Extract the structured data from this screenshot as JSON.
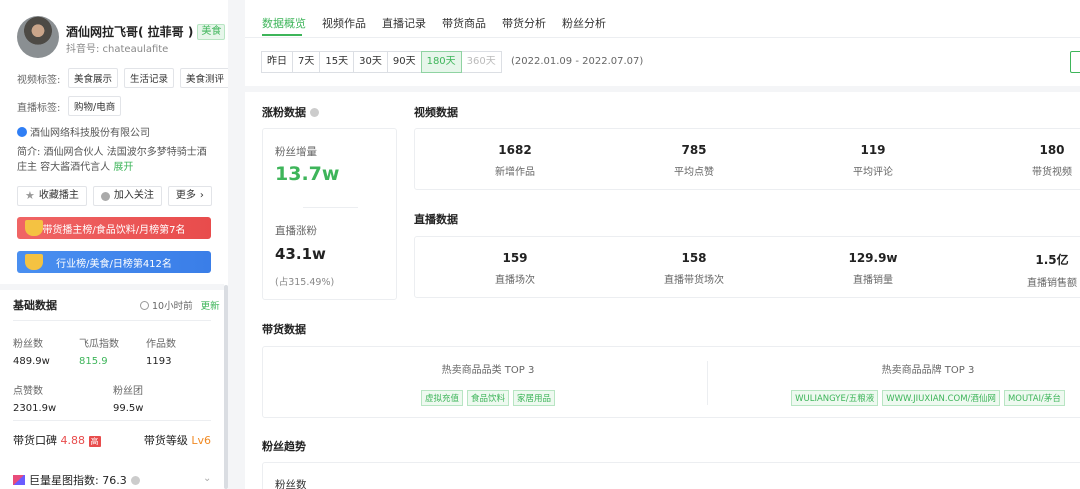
{
  "profile": {
    "name": "酒仙网拉飞哥( 拉菲哥 )",
    "category_tag": "美食",
    "douyin_id": "抖音号: chateaulafite",
    "video_tags_label": "视频标签:",
    "video_tags": [
      "美食展示",
      "生活记录",
      "美食测评"
    ],
    "live_tags_label": "直播标签:",
    "live_tags": [
      "购物/电商"
    ],
    "verified_org": "酒仙网络科技股份有限公司",
    "intro": "简介: 酒仙网合伙人 法国波尔多梦特骑士酒庄主 容大酱酒代言人",
    "intro_more": "展开",
    "actions": {
      "collect": "收藏播主",
      "follow": "加入关注",
      "more": "更多"
    },
    "rank_red": "带货播主榜/食品饮料/月榜第7名",
    "rank_blue": "行业榜/美食/日榜第412名"
  },
  "basic": {
    "title": "基础数据",
    "updated": "10小时前",
    "update_link": "更新",
    "stats": [
      {
        "label": "粉丝数",
        "value": "489.9w"
      },
      {
        "label": "飞瓜指数",
        "value": "815.9"
      },
      {
        "label": "作品数",
        "value": "1193"
      },
      {
        "label": "点赞数",
        "value": "2301.9w"
      },
      {
        "label": "粉丝团",
        "value": "99.5w"
      }
    ],
    "reputation_label": "带货口碑",
    "reputation_score": "4.88",
    "reputation_badge": "高",
    "level_label": "带货等级",
    "level_value": "Lv6",
    "star_index": "巨量星图指数: 76.3"
  },
  "tabs": [
    "数据概览",
    "视频作品",
    "直播记录",
    "带货商品",
    "带货分析",
    "粉丝分析"
  ],
  "ranges": [
    "昨日",
    "7天",
    "15天",
    "30天",
    "90天",
    "180天",
    "360天"
  ],
  "date_range": "(2022.01.09 - 2022.07.07)",
  "fans": {
    "title": "涨粉数据",
    "growth_label": "粉丝增量",
    "growth_value": "13.7w",
    "live_label": "直播涨粉",
    "live_value": "43.1w",
    "live_share": "(占315.49%)"
  },
  "video": {
    "title": "视频数据",
    "metrics": [
      {
        "value": "1682",
        "label": "新增作品"
      },
      {
        "value": "785",
        "label": "平均点赞"
      },
      {
        "value": "119",
        "label": "平均评论"
      },
      {
        "value": "180",
        "label": "带货视频"
      }
    ]
  },
  "live": {
    "title": "直播数据",
    "metrics": [
      {
        "value": "159",
        "label": "直播场次"
      },
      {
        "value": "158",
        "label": "直播带货场次"
      },
      {
        "value": "129.9w",
        "label": "直播销量"
      },
      {
        "value": "1.5亿",
        "label": "直播销售额"
      }
    ]
  },
  "goods": {
    "title": "带货数据",
    "category_title": "热卖商品品类 TOP 3",
    "categories": [
      "虚拟充值",
      "食品饮料",
      "家居用品"
    ],
    "brand_title": "热卖商品品牌 TOP 3",
    "brands": [
      "WULIANGYE/五粮液",
      "WWW.JIUXIAN.COM/酒仙网",
      "MOUTAI/茅台"
    ]
  },
  "trend": {
    "title": "粉丝趋势",
    "label": "粉丝数"
  },
  "colors": {
    "accent": "#3eb55a",
    "rank_red": "#e84c4c",
    "rank_blue": "#3a7ee8",
    "level": "#f08a24"
  }
}
